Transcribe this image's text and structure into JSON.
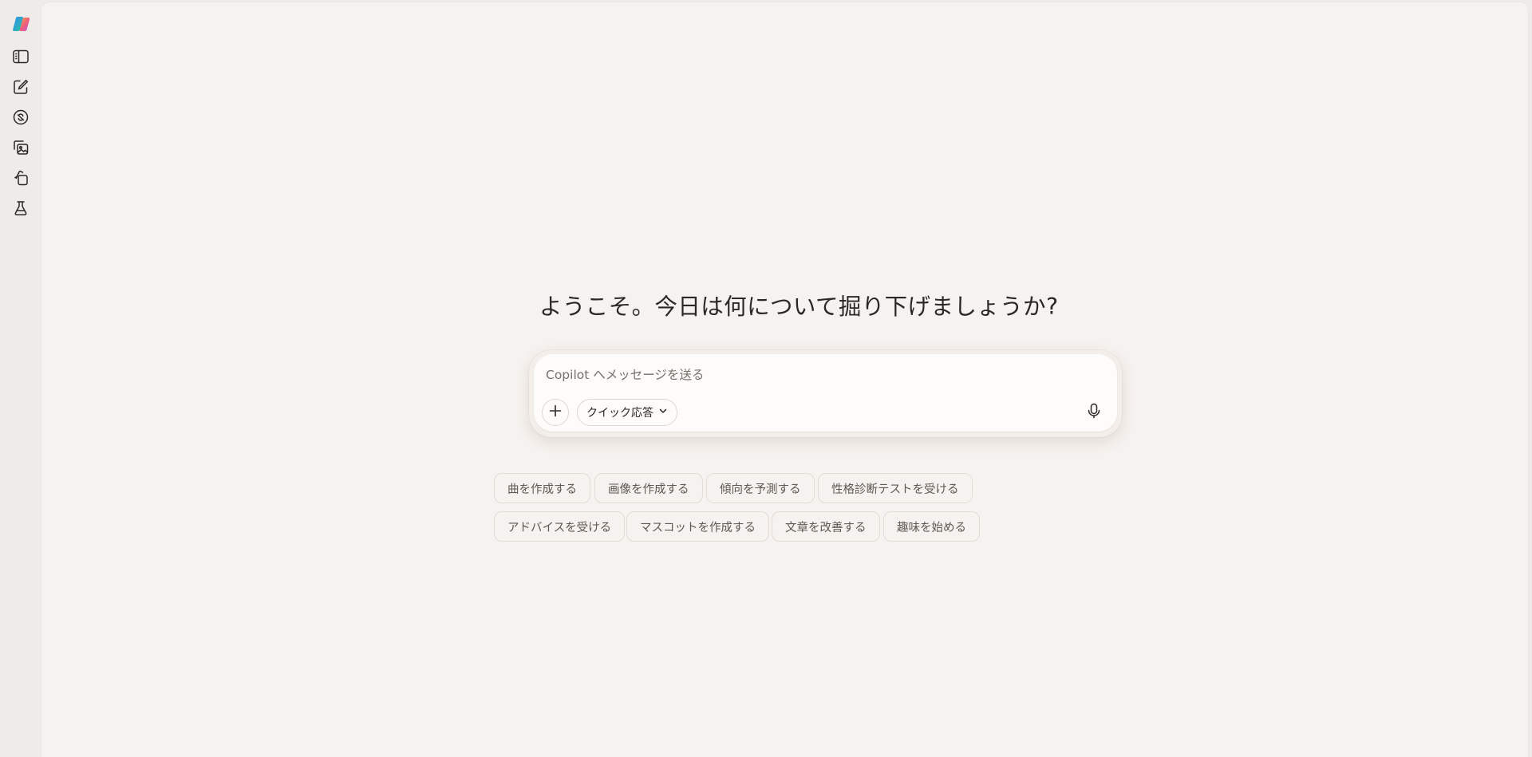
{
  "sidebar": {
    "items": [
      {
        "name": "copilot-logo-icon"
      },
      {
        "name": "sidebar-toggle-icon"
      },
      {
        "name": "new-chat-icon"
      },
      {
        "name": "discover-icon"
      },
      {
        "name": "image-gallery-icon"
      },
      {
        "name": "pages-icon"
      },
      {
        "name": "labs-icon"
      }
    ]
  },
  "main": {
    "headline": "ようこそ。今日は何について掘り下げましょうか?",
    "composer": {
      "placeholder": "Copilot へメッセージを送る",
      "value": "",
      "mode_label": "クイック応答"
    },
    "suggestions_row1": [
      "曲を作成する",
      "画像を作成する",
      "傾向を予測する",
      "性格診断テストを受ける"
    ],
    "suggestions_row2": [
      "アドバイスを受ける",
      "マスコットを作成する",
      "文章を改善する",
      "趣味を始める"
    ]
  },
  "colors": {
    "rail_bg": "#efebe8",
    "main_bg": "#f6f2ef",
    "composer_bg": "#fdfcfa",
    "text": "#2b2724",
    "muted_text": "#5f5852"
  }
}
